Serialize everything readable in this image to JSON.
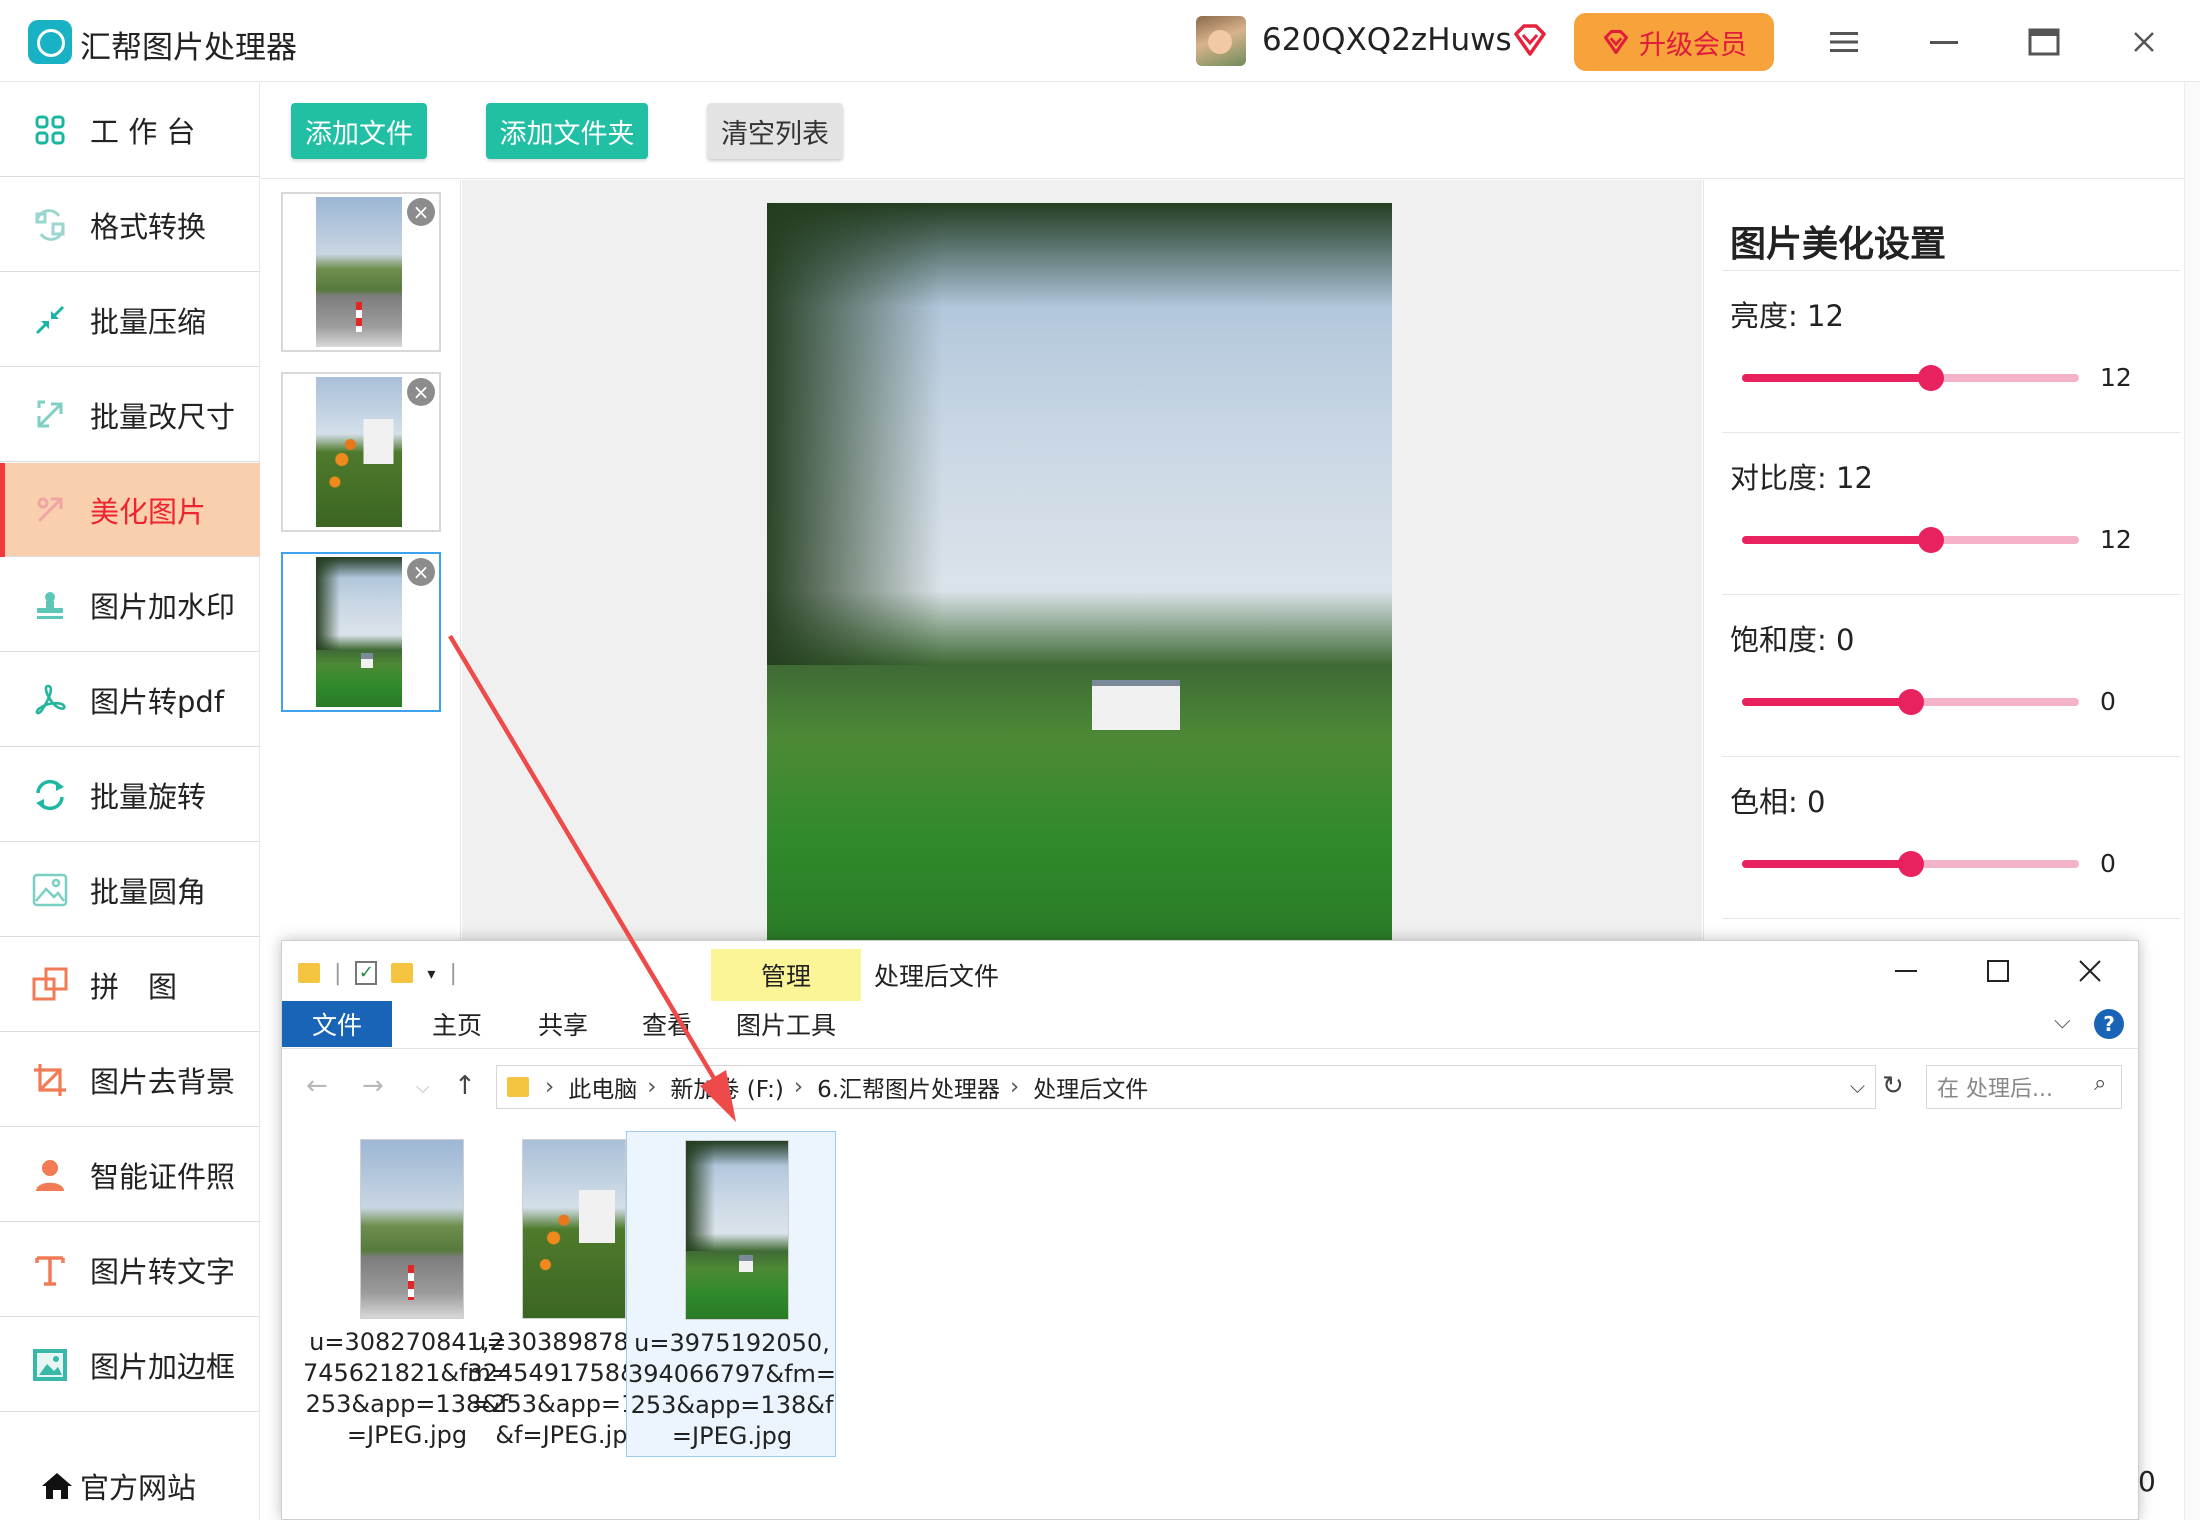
{
  "app": {
    "title": "汇帮图片处理器",
    "username": "620QXQ2zHuws",
    "upgrade_label": "升级会员",
    "icons": {
      "logo": "app-logo-icon",
      "vip": "diamond-icon",
      "menu": "hamburger-icon",
      "minimize": "minimize-icon",
      "maximize": "maximize-icon",
      "close": "close-icon"
    }
  },
  "sidebar": {
    "items": [
      {
        "label": "工 作 台",
        "icon": "grid-icon"
      },
      {
        "label": "格式转换",
        "icon": "convert-icon"
      },
      {
        "label": "批量压缩",
        "icon": "compress-icon"
      },
      {
        "label": "批量改尺寸",
        "icon": "resize-icon"
      },
      {
        "label": "美化图片",
        "icon": "beautify-icon"
      },
      {
        "label": "图片加水印",
        "icon": "watermark-icon"
      },
      {
        "label": "图片转pdf",
        "icon": "pdf-icon"
      },
      {
        "label": "批量旋转",
        "icon": "rotate-icon"
      },
      {
        "label": "批量圆角",
        "icon": "round-corner-icon"
      },
      {
        "label": "拼　图",
        "icon": "puzzle-icon"
      },
      {
        "label": "图片去背景",
        "icon": "crop-icon"
      },
      {
        "label": "智能证件照",
        "icon": "person-icon"
      },
      {
        "label": "图片转文字",
        "icon": "text-icon"
      },
      {
        "label": "图片加边框",
        "icon": "frame-icon"
      }
    ],
    "active_index": 4,
    "official_site": "官方网站"
  },
  "toolbar": {
    "add_file": "添加文件",
    "add_folder": "添加文件夹",
    "clear_list": "清空列表"
  },
  "thumbnails": {
    "count": 3,
    "selected_index": 2,
    "remove_icon": "remove-icon"
  },
  "settings": {
    "title": "图片美化设置",
    "sliders": [
      {
        "label": "亮度: 12",
        "value": 12,
        "min": -100,
        "max": 100
      },
      {
        "label": "对比度: 12",
        "value": 12,
        "min": -100,
        "max": 100
      },
      {
        "label": "饱和度: 0",
        "value": 0,
        "min": -100,
        "max": 100
      },
      {
        "label": "色相: 0",
        "value": 0,
        "min": -100,
        "max": 100
      }
    ],
    "colors": {
      "fill": "#e8215f",
      "track": "#f4b2c9"
    }
  },
  "explorer": {
    "title": "处理后文件",
    "manage_tab": "管理",
    "ribbon_tabs": [
      "文件",
      "主页",
      "共享",
      "查看",
      "图片工具"
    ],
    "address": [
      "此电脑",
      "新加卷 (F:)",
      "6.汇帮图片处理器",
      "处理后文件"
    ],
    "search_placeholder": "在 处理后...",
    "files": [
      {
        "name": "u=308270841,2745621821&fm=253&app=138&f=JPEG.jpg",
        "image": "road"
      },
      {
        "name": "u=3038987841,3245491758&fm=253&app=138&f=JPEG.jpg",
        "image": "flower"
      },
      {
        "name": "u=3975192050,394066797&fm=253&app=138&f=JPEG.jpg",
        "image": "field"
      }
    ],
    "selected_file_index": 2
  },
  "edge_text": "0",
  "colors": {
    "accent_green": "#21bfa4",
    "active_nav_bg": "#f9cfae",
    "active_nav_text": "#f0242e",
    "upgrade_bg": "#f7a23a",
    "arrow": "#ef4a4a"
  }
}
